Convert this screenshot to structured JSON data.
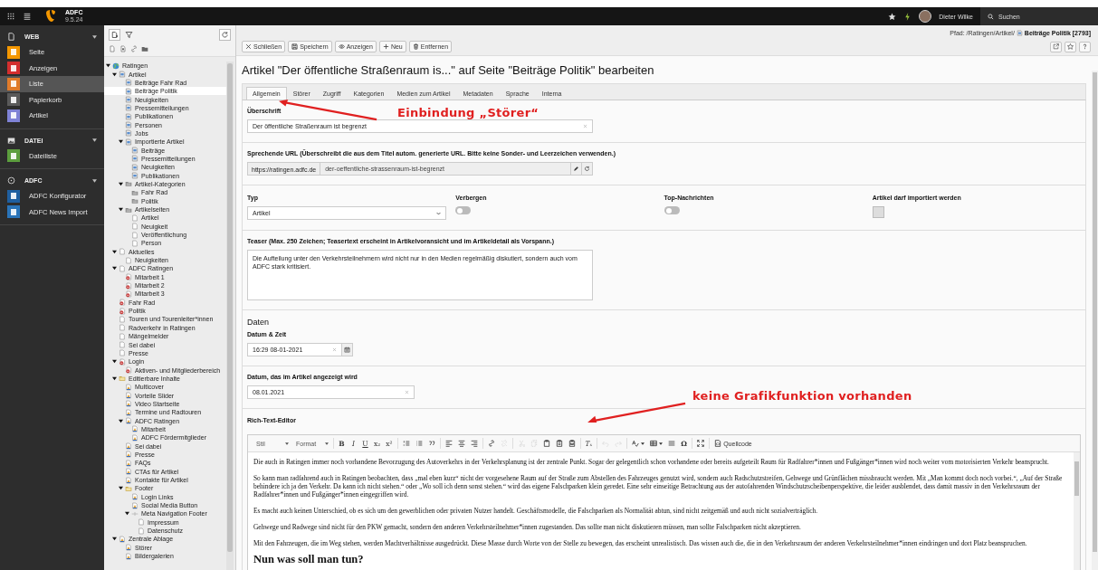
{
  "topbar": {
    "app_name": "ADFC",
    "version": "9.5.24",
    "user": "Dieter Wilke",
    "search_label": "Suchen"
  },
  "modules": [
    {
      "title": "WEB",
      "kind": "page",
      "items": [
        {
          "label": "Seite",
          "color": "#f49700",
          "selected": false
        },
        {
          "label": "Anzeigen",
          "color": "#d32e2e",
          "selected": false
        },
        {
          "label": "Liste",
          "color": "#e07b2a",
          "selected": true
        },
        {
          "label": "Papierkorb",
          "color": "#5a5a5a",
          "selected": false
        },
        {
          "label": "Artikel",
          "color": "#7f83d6",
          "selected": false
        }
      ]
    },
    {
      "title": "DATEI",
      "kind": "image",
      "items": [
        {
          "label": "Dateiliste",
          "color": "#5c9e3e",
          "selected": false
        }
      ]
    },
    {
      "title": "ADFC",
      "kind": "circle",
      "items": [
        {
          "label": "ADFC Konfigurator",
          "color": "#1f5fa0",
          "selected": false
        },
        {
          "label": "ADFC News Import",
          "color": "#2a74b8",
          "selected": false
        }
      ]
    }
  ],
  "page_tree": [
    {
      "label": "Ratingen",
      "kind": "site",
      "selected": false,
      "children": [
        {
          "label": "Artikel",
          "kind": "folder",
          "selected": false,
          "children": [
            {
              "label": "Beiträge Fahr Rad",
              "kind": "folder",
              "selected": false
            },
            {
              "label": "Beiträge Politik",
              "kind": "folder",
              "selected": true
            },
            {
              "label": "Neuigkeiten",
              "kind": "folder",
              "selected": false
            },
            {
              "label": "Pressemitteilungen",
              "kind": "folder",
              "selected": false
            },
            {
              "label": "Publikationen",
              "kind": "folder",
              "selected": false
            },
            {
              "label": "Personen",
              "kind": "folder",
              "selected": false
            },
            {
              "label": "Jobs",
              "kind": "folder",
              "selected": false
            },
            {
              "label": "Importierte Artikel",
              "kind": "folder",
              "selected": false,
              "children": [
                {
                  "label": "Beiträge",
                  "kind": "folder",
                  "selected": false
                },
                {
                  "label": "Pressemitteilungen",
                  "kind": "folder",
                  "selected": false
                },
                {
                  "label": "Neuigkeiten",
                  "kind": "folder",
                  "selected": false
                },
                {
                  "label": "Publikationen",
                  "kind": "folder",
                  "selected": false
                }
              ]
            },
            {
              "label": "Artikel-Kategorien",
              "kind": "category",
              "selected": false,
              "children": [
                {
                  "label": "Fahr Rad",
                  "kind": "category",
                  "selected": false
                },
                {
                  "label": "Politik",
                  "kind": "category",
                  "selected": false
                }
              ]
            },
            {
              "label": "Artikelseiten",
              "kind": "category",
              "selected": false,
              "children": [
                {
                  "label": "Artikel",
                  "kind": "page",
                  "selected": false
                },
                {
                  "label": "Neuigkeit",
                  "kind": "page",
                  "selected": false
                },
                {
                  "label": "Veröffentlichung",
                  "kind": "page",
                  "selected": false
                },
                {
                  "label": "Person",
                  "kind": "page",
                  "selected": false
                }
              ]
            }
          ]
        },
        {
          "label": "Aktuelles",
          "kind": "page",
          "selected": false,
          "children": [
            {
              "label": "Neuigkeiten",
              "kind": "page",
              "selected": false
            }
          ]
        },
        {
          "label": "ADFC Ratingen",
          "kind": "page",
          "selected": false,
          "children": [
            {
              "label": "Mitarbeit 1",
              "kind": "hidden",
              "selected": false
            },
            {
              "label": "Mitarbeit 2",
              "kind": "hidden",
              "selected": false
            },
            {
              "label": "Mitarbeit 3",
              "kind": "hidden",
              "selected": false
            }
          ]
        },
        {
          "label": "Fahr Rad",
          "kind": "hidden",
          "selected": false
        },
        {
          "label": "Politik",
          "kind": "hidden",
          "selected": false
        },
        {
          "label": "Touren und Tourenleiter*innen",
          "kind": "page",
          "selected": false
        },
        {
          "label": "Radverkehr in Ratingen",
          "kind": "page",
          "selected": false
        },
        {
          "label": "Mängelmelder",
          "kind": "page",
          "selected": false
        },
        {
          "label": "Sei dabei",
          "kind": "page",
          "selected": false
        },
        {
          "label": "Presse",
          "kind": "page",
          "selected": false
        },
        {
          "label": "Login",
          "kind": "hidden",
          "selected": false,
          "children": [
            {
              "label": "Aktiven- und Mitgliederbereich",
              "kind": "hidden",
              "selected": false
            }
          ]
        },
        {
          "label": "Editierbare Inhalte",
          "kind": "storage",
          "selected": false,
          "children": [
            {
              "label": "Multicover",
              "kind": "content",
              "selected": false
            },
            {
              "label": "Vorteile Slider",
              "kind": "content",
              "selected": false
            },
            {
              "label": "Video Startseite",
              "kind": "content",
              "selected": false
            },
            {
              "label": "Termine und Radtouren",
              "kind": "content",
              "selected": false
            },
            {
              "label": "ADFC Ratingen",
              "kind": "content",
              "selected": false,
              "children": [
                {
                  "label": "Mitarbeit",
                  "kind": "content",
                  "selected": false
                },
                {
                  "label": "ADFC Fördermitglieder",
                  "kind": "content",
                  "selected": false
                }
              ]
            },
            {
              "label": "Sei dabei",
              "kind": "content",
              "selected": false
            },
            {
              "label": "Presse",
              "kind": "content",
              "selected": false
            },
            {
              "label": "FAQs",
              "kind": "content",
              "selected": false
            },
            {
              "label": "CTAs für Artikel",
              "kind": "content",
              "selected": false
            },
            {
              "label": "Kontakte für Artikel",
              "kind": "content",
              "selected": false
            },
            {
              "label": "Footer",
              "kind": "storage",
              "selected": false,
              "children": [
                {
                  "label": "Login Links",
                  "kind": "content",
                  "selected": false
                },
                {
                  "label": "Social Media Button",
                  "kind": "content",
                  "selected": false
                },
                {
                  "label": "Meta Navigation Footer",
                  "kind": "spacer",
                  "selected": false,
                  "children": [
                    {
                      "label": "Impressum",
                      "kind": "page",
                      "selected": false
                    },
                    {
                      "label": "Datenschutz",
                      "kind": "page",
                      "selected": false
                    }
                  ]
                }
              ]
            }
          ]
        },
        {
          "label": "Zentrale Ablage",
          "kind": "content",
          "selected": false,
          "children": [
            {
              "label": "Störer",
              "kind": "content",
              "selected": false
            },
            {
              "label": "Bildergalerien",
              "kind": "content",
              "selected": false
            }
          ]
        }
      ]
    }
  ],
  "docheader": {
    "buttons": [
      {
        "label": "Schließen",
        "kind": "close"
      },
      {
        "label": "Speichern",
        "kind": "save"
      },
      {
        "label": "Anzeigen",
        "kind": "view"
      },
      {
        "label": "Neu",
        "kind": "new"
      },
      {
        "label": "Entfernen",
        "kind": "delete"
      }
    ],
    "path_prefix": "Pfad: /Ratingen/Artikel/",
    "path_page": "Beiträge Politik [2793]"
  },
  "title": "Artikel \"Der öffentliche Straßenraum is...\" auf Seite \"Beiträge Politik\" bearbeiten",
  "tabs": [
    {
      "label": "Allgemein",
      "selected": true
    },
    {
      "label": "Störer",
      "selected": false
    },
    {
      "label": "Zugriff",
      "selected": false
    },
    {
      "label": "Kategorien",
      "selected": false
    },
    {
      "label": "Medien zum Artikel",
      "selected": false
    },
    {
      "label": "Metadaten",
      "selected": false
    },
    {
      "label": "Sprache",
      "selected": false
    },
    {
      "label": "Interna",
      "selected": false
    }
  ],
  "form": {
    "headline": {
      "label": "Überschrift",
      "value": "Der öffentliche Straßenraum ist begrenzt"
    },
    "slug": {
      "label": "Sprechende URL (Überschreibt die aus dem Titel autom. generierte URL. Bitte keine Sonder- und Leerzeichen verwenden.)",
      "prefix": "https://ratingen.adfc.de",
      "value": "der-oeffentliche-strassenraum-ist-begrenzt"
    },
    "options": [
      {
        "kind": "select",
        "label": "Typ",
        "value": "Artikel"
      },
      {
        "kind": "toggle",
        "label": "Verbergen",
        "on": false
      },
      {
        "kind": "toggle",
        "label": "Top-Nachrichten",
        "on": false
      },
      {
        "kind": "checkbox",
        "label": "Artikel darf importiert werden",
        "checked": false,
        "disabled": true
      }
    ],
    "teaser": {
      "label": "Teaser (Max. 250 Zeichen; Teasertext erscheint in Artikelvoransicht und im Artikeldetail als Vorspann.)",
      "value": "Die Aufteilung unter den Verkehrsteilnehmern wird nicht nur in den Medien regelmäßig diskutiert, sondern auch vom ADFC stark kritisiert."
    },
    "dates_heading": "Daten",
    "date_time": {
      "label": "Datum & Zeit",
      "value": "16:29 08-01-2021"
    },
    "display_date": {
      "label": "Datum, das im Artikel angezeigt wird",
      "value": "08.01.2021"
    },
    "rte": {
      "label": "Rich-Text-Editor",
      "toolbar": [
        [
          {
            "kind": "dropdown",
            "label": "Stil",
            "disabled": false
          },
          {
            "kind": "dropdown",
            "label": "Format",
            "disabled": false
          }
        ],
        [
          {
            "kind": "bold",
            "label": "B",
            "disabled": false
          },
          {
            "kind": "italic",
            "label": "I",
            "disabled": false
          },
          {
            "kind": "underline",
            "label": "U",
            "disabled": false
          },
          {
            "kind": "subscript",
            "label": "x₂",
            "disabled": false
          },
          {
            "kind": "superscript",
            "label": "x²",
            "disabled": false
          }
        ],
        [
          {
            "kind": "numbered-list",
            "disabled": false
          },
          {
            "kind": "bullet-list",
            "disabled": false
          },
          {
            "kind": "quote",
            "disabled": false
          }
        ],
        [
          {
            "kind": "align-left",
            "disabled": false
          },
          {
            "kind": "align-center",
            "disabled": false
          },
          {
            "kind": "align-right",
            "disabled": false
          }
        ],
        [
          {
            "kind": "link",
            "disabled": false
          },
          {
            "kind": "unlink",
            "disabled": true
          }
        ],
        [
          {
            "kind": "cut",
            "disabled": true
          },
          {
            "kind": "copy",
            "disabled": true
          },
          {
            "kind": "paste",
            "disabled": false
          },
          {
            "kind": "paste-text",
            "disabled": false
          },
          {
            "kind": "paste-word",
            "disabled": false
          }
        ],
        [
          {
            "kind": "clear-format",
            "label": "Tₓ",
            "disabled": false
          }
        ],
        [
          {
            "kind": "undo",
            "disabled": true
          },
          {
            "kind": "redo",
            "disabled": true
          }
        ],
        [
          {
            "kind": "spellcheck",
            "disabled": false
          },
          {
            "kind": "table",
            "disabled": false
          },
          {
            "kind": "horizontal-rule",
            "disabled": false
          },
          {
            "kind": "symbol",
            "label": "Ω",
            "disabled": false
          }
        ],
        [
          {
            "kind": "maximize",
            "disabled": false
          }
        ],
        [
          {
            "kind": "source",
            "label": "Quellcode",
            "disabled": false
          }
        ]
      ],
      "paragraphs": [
        "Die auch in Ratingen immer noch vorhandene Bevorzugung des Autoverkehrs in der Verkehrsplanung ist der zentrale Punkt. Sogar der gelegentlich schon vorhandene oder bereits aufgeteilt Raum für Radfahrer*innen und Fußgänger*innen wird noch weiter vom motorisierten Verkehr beansprucht.",
        "So kann man radfahrend auch in Ratingen beobachten, dass „mal eben kurz“ nicht der vorgesehene Raum auf der Straße zum Abstellen des Fahrzeuges genutzt wird, sondern auch Radschutzstreifen, Gehwege und Grünflächen missbraucht werden. Mit „Man kommt doch noch vorbei.“, „Auf der Straße behindere ich ja den Verkehr. Da kann ich nicht stehen.“ oder „Wo soll ich denn sonst stehen.“ wird das eigene Falschparken klein geredet. Eine sehr einseitige Betrachtung aus der autofahrenden Windschutzscheibenperspektive, die leider ausblendet, dass damit massiv in den Verkehrsraum der Radfahrer*innen und Fußgänger*innen eingegriffen wird.",
        "Es macht auch keinen Unterschied, ob es sich um den gewerblichen oder privaten Nutzer handelt. Geschäftsmodelle, die Falschparken als Normalität abtun, sind nicht zeitgemäß und auch nicht sozialverträglich.",
        "Gehwege und Radwege sind nicht für den PKW gemacht, sondern den anderen Verkehrsteilnehmer*innen zugestanden. Das sollte man nicht diskutieren müssen, man sollte Falschparken nicht akzeptieren.",
        "Mit den Fahrzeugen, die im Weg stehen, werden Machtverhältnisse ausgedrückt. Diese Masse durch Worte von der Stelle zu bewegen, das erscheint unrealistisch. Das wissen auch die, die in den Verkehrsraum der anderen Verkehrsteilnehmer*innen eindringen und dort Platz beanspruchen."
      ],
      "heading": "Nun was soll man tun?"
    }
  },
  "annotations": [
    {
      "text": "Einbindung „Störer“"
    },
    {
      "text": "keine Grafikfunktion vorhanden"
    }
  ]
}
